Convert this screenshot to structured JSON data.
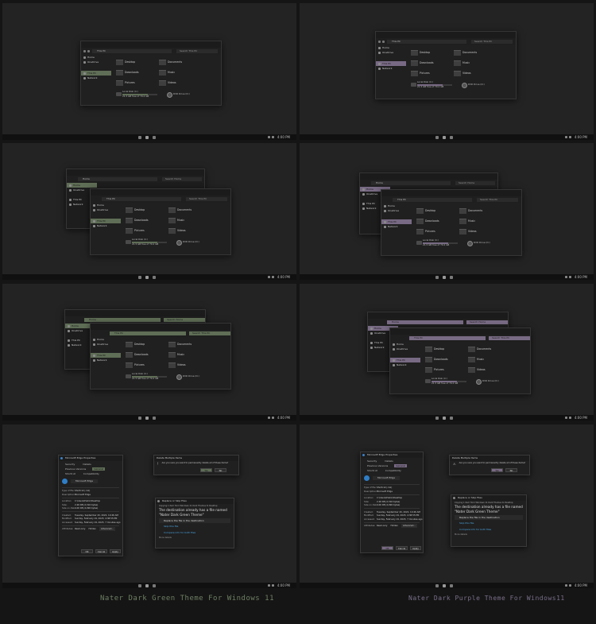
{
  "taskbar": {
    "time": "4:00 PM"
  },
  "colors": {
    "green_accent": "#5f6e56",
    "purple_accent": "#786a84",
    "caption_green": "#6e7f63",
    "caption_purple": "#7a6f8a",
    "link_blue": "#4aa3df"
  },
  "explorer": {
    "address_home": "Home",
    "address_thispc": "This PC",
    "search_home": "Search Home",
    "search_thispc": "Search This PC",
    "sidebar": [
      "Home",
      "OneDrive",
      "This PC",
      "Network"
    ],
    "folders": [
      "Desktop",
      "Documents",
      "Downloads",
      "Music",
      "Pictures",
      "Videos"
    ],
    "drive_c": {
      "name": "Local Disk (C:)",
      "free": "21.5 GB free of 79.2 GB"
    },
    "drive_d": {
      "name": "DVD Drive (D:)"
    }
  },
  "properties": {
    "title": "Microsoft Edge Properties",
    "tabs": [
      "General",
      "Details",
      "Previous Versions",
      "Security",
      "Compatibility",
      "Shortcut"
    ],
    "name": "Microsoft Edge",
    "rows": [
      {
        "k": "Type of file:",
        "v": "Shortcut (.lnk)"
      },
      {
        "k": "Description:",
        "v": "Microsoft Edge"
      },
      {
        "k": "Location:",
        "v": "C:\\Users\\Public\\Desktop"
      },
      {
        "k": "Size:",
        "v": "2.26 KB (2,316 bytes)"
      },
      {
        "k": "Size on disk:",
        "v": "4.00 KB (4,096 bytes)"
      },
      {
        "k": "Created:",
        "v": "Tuesday, September 20, 2022, 10:46 AM"
      },
      {
        "k": "Modified:",
        "v": "Sunday, February 19, 2023, 4:38:55 PM"
      },
      {
        "k": "Accessed:",
        "v": "Sunday, February 19, 2023, 7 minutes ago"
      }
    ],
    "attributes_label": "Attributes:",
    "readonly": "Read-only",
    "hidden": "Hidden",
    "advanced": "Advanced...",
    "ok": "OK",
    "cancel": "Cancel",
    "apply": "Apply"
  },
  "delete_dialog": {
    "title": "Delete Multiple Items",
    "text": "Are you sure you want to permanently delete all of these items?",
    "yes": "Yes",
    "no": "No"
  },
  "replace_dialog": {
    "title": "Replace or Skip Files",
    "copying": "Copying 1 item from Windows 11 Dark Themes to Desktop",
    "message": "The destination already has a file named \"Nater Dark Green Theme\"",
    "message_purple": "The destination already has a file named \"Nater Dark Green Theme\"",
    "opt_replace": "Replace the file in the destination",
    "opt_skip": "Skip this file",
    "opt_compare": "Compare info for both files",
    "more": "More details"
  },
  "captions": {
    "green": "Nater Dark Green Theme For Windows 11",
    "purple": "Nater Dark Purple Theme For Windows11"
  }
}
